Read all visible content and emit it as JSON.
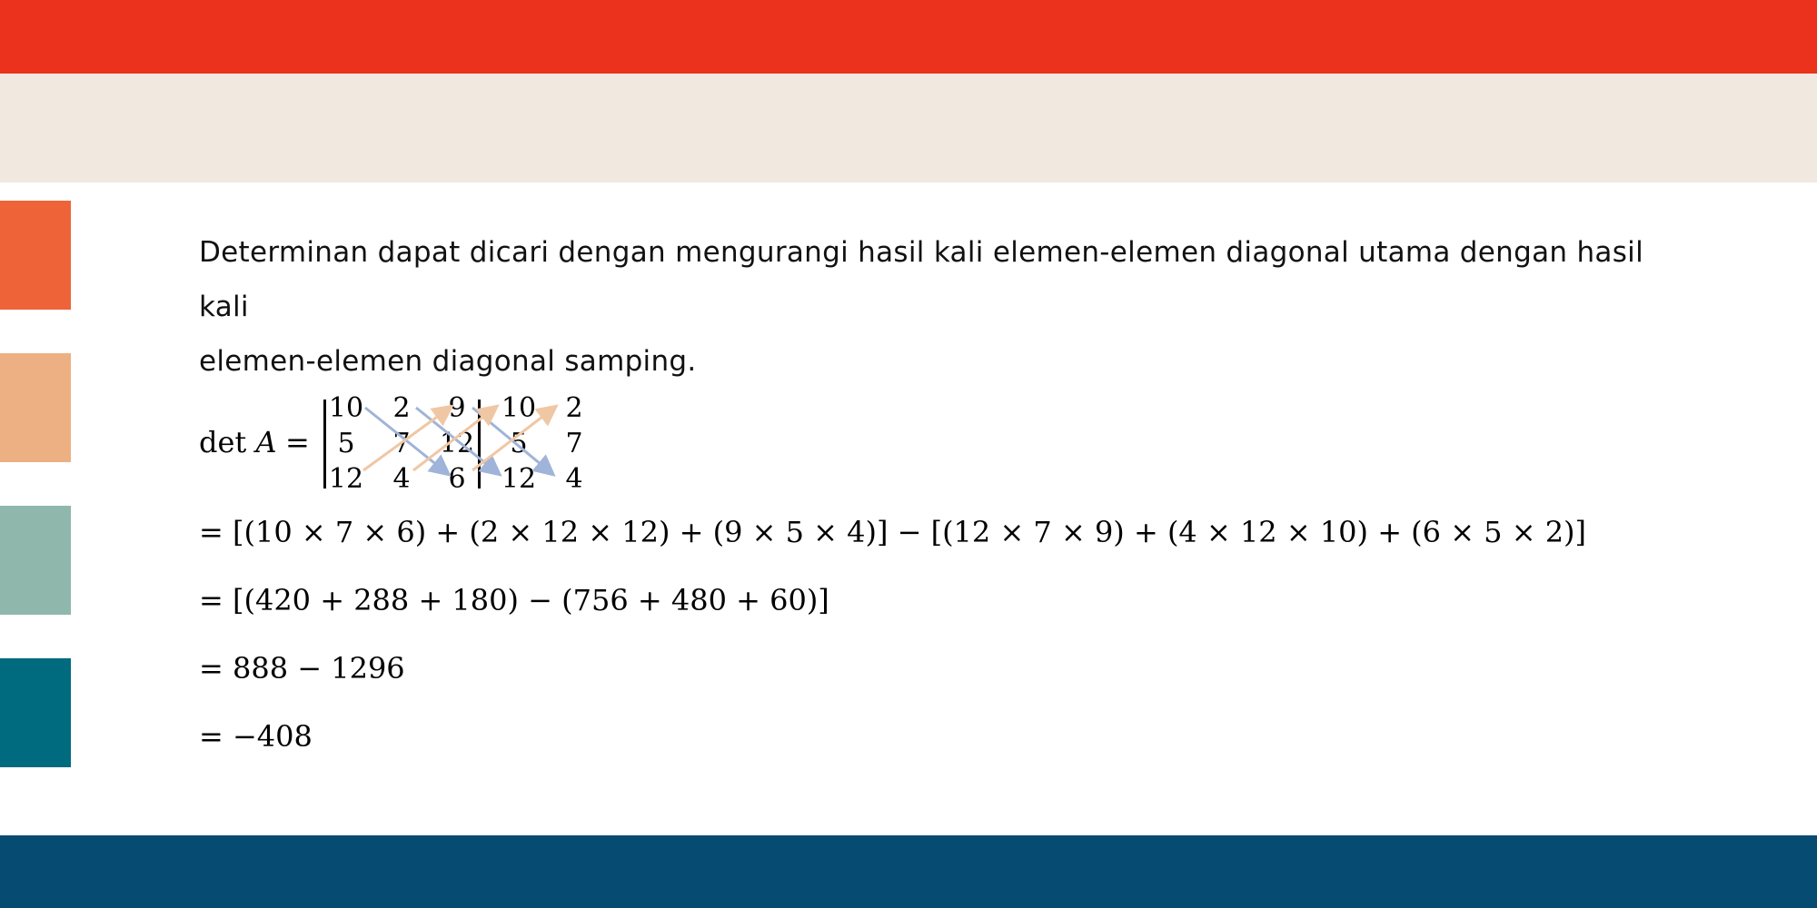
{
  "intro_line1": "Determinan dapat dicari dengan mengurangi hasil kali elemen-elemen diagonal utama dengan hasil kali",
  "intro_line2": "elemen-elemen diagonal samping.",
  "det_label": "det",
  "det_var": "A",
  "det_equals": "=",
  "matrix": [
    [
      "10",
      "2",
      "9"
    ],
    [
      "5",
      "7",
      "12"
    ],
    [
      "12",
      "4",
      "6"
    ]
  ],
  "extension": [
    [
      "10",
      "2"
    ],
    [
      "5",
      "7"
    ],
    [
      "12",
      "4"
    ]
  ],
  "steps": [
    "= [(10 × 7 × 6) + (2 × 12 × 12) + (9 × 5 × 4)] − [(12 × 7 × 9) + (4 × 12 × 10) + (6 × 5 × 2)]",
    "= [(420 + 288 + 180) − (756 + 480 + 60)]",
    "= 888 − 1296",
    "= −408"
  ],
  "colors": {
    "top_band": "#ea321c",
    "cream_band": "#f1e9e0",
    "bottom_band": "#064c72",
    "swatches": [
      "#ef6338",
      "#edb083",
      "#8fb7ac",
      "#006a7f"
    ],
    "main_diagonal_arrows": "#9fb4d8",
    "side_diagonal_arrows": "#f0c7a4"
  }
}
